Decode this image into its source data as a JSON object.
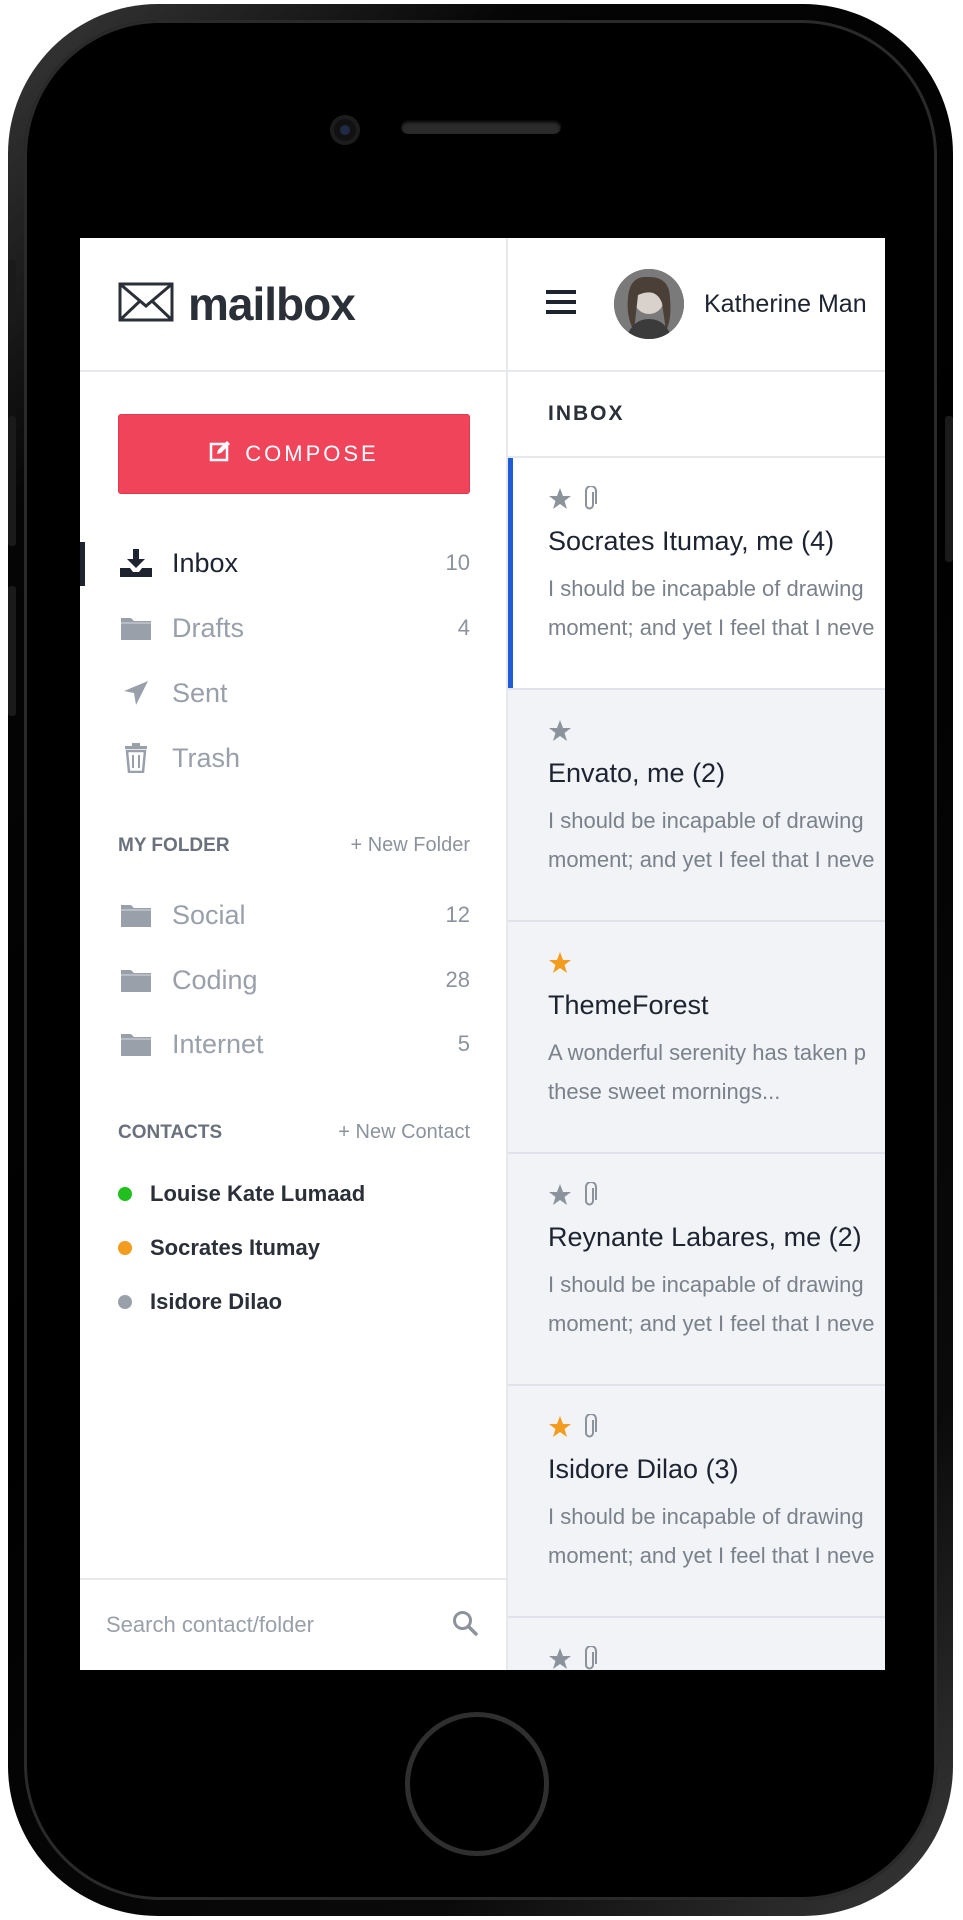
{
  "brand": {
    "name": "mailbox"
  },
  "compose_label": "COMPOSE",
  "nav": [
    {
      "label": "Inbox",
      "count": "10",
      "icon": "inbox-download-icon",
      "active": true
    },
    {
      "label": "Drafts",
      "count": "4",
      "icon": "folder-icon"
    },
    {
      "label": "Sent",
      "count": "",
      "icon": "paper-plane-icon"
    },
    {
      "label": "Trash",
      "count": "",
      "icon": "trash-icon"
    }
  ],
  "my_folder": {
    "title": "MY FOLDER",
    "action": "+ New Folder",
    "items": [
      {
        "label": "Social",
        "count": "12"
      },
      {
        "label": "Coding",
        "count": "28"
      },
      {
        "label": "Internet",
        "count": "5"
      }
    ]
  },
  "contacts": {
    "title": "CONTACTS",
    "action": "+ New Contact",
    "items": [
      {
        "name": "Louise Kate Lumaad",
        "status_color": "#22c01e"
      },
      {
        "name": "Socrates Itumay",
        "status_color": "#f39c1f"
      },
      {
        "name": "Isidore Dilao",
        "status_color": "#9aa0aa"
      }
    ]
  },
  "search": {
    "placeholder": "Search contact/folder"
  },
  "header": {
    "user_name": "Katherine Man"
  },
  "inbox_title": "INBOX",
  "colors": {
    "accent_red": "#f0445a",
    "selected_blue": "#1e5bd6",
    "star_orange": "#f39c1f",
    "star_gray": "#8d939d"
  },
  "mails": [
    {
      "from": "Socrates Itumay, me (4)",
      "line1": "I should be incapable of drawing",
      "line2": "moment; and yet I feel that I neve",
      "starred": false,
      "attachment": true,
      "selected": true
    },
    {
      "from": "Envato, me (2)",
      "line1": "I should be incapable of drawing",
      "line2": "moment; and yet I feel that I neve",
      "starred": false,
      "attachment": false
    },
    {
      "from": "ThemeForest",
      "line1": "A wonderful serenity has taken p",
      "line2": "these sweet mornings...",
      "starred": true,
      "attachment": false
    },
    {
      "from": "Reynante Labares, me (2)",
      "line1": "I should be incapable of drawing",
      "line2": "moment; and yet I feel that I neve",
      "starred": false,
      "attachment": true
    },
    {
      "from": "Isidore Dilao (3)",
      "line1": "I should be incapable of drawing",
      "line2": "moment; and yet I feel that I neve",
      "starred": true,
      "attachment": true
    },
    {
      "from": "",
      "line1": "",
      "line2": "",
      "starred": false,
      "attachment": true
    }
  ]
}
